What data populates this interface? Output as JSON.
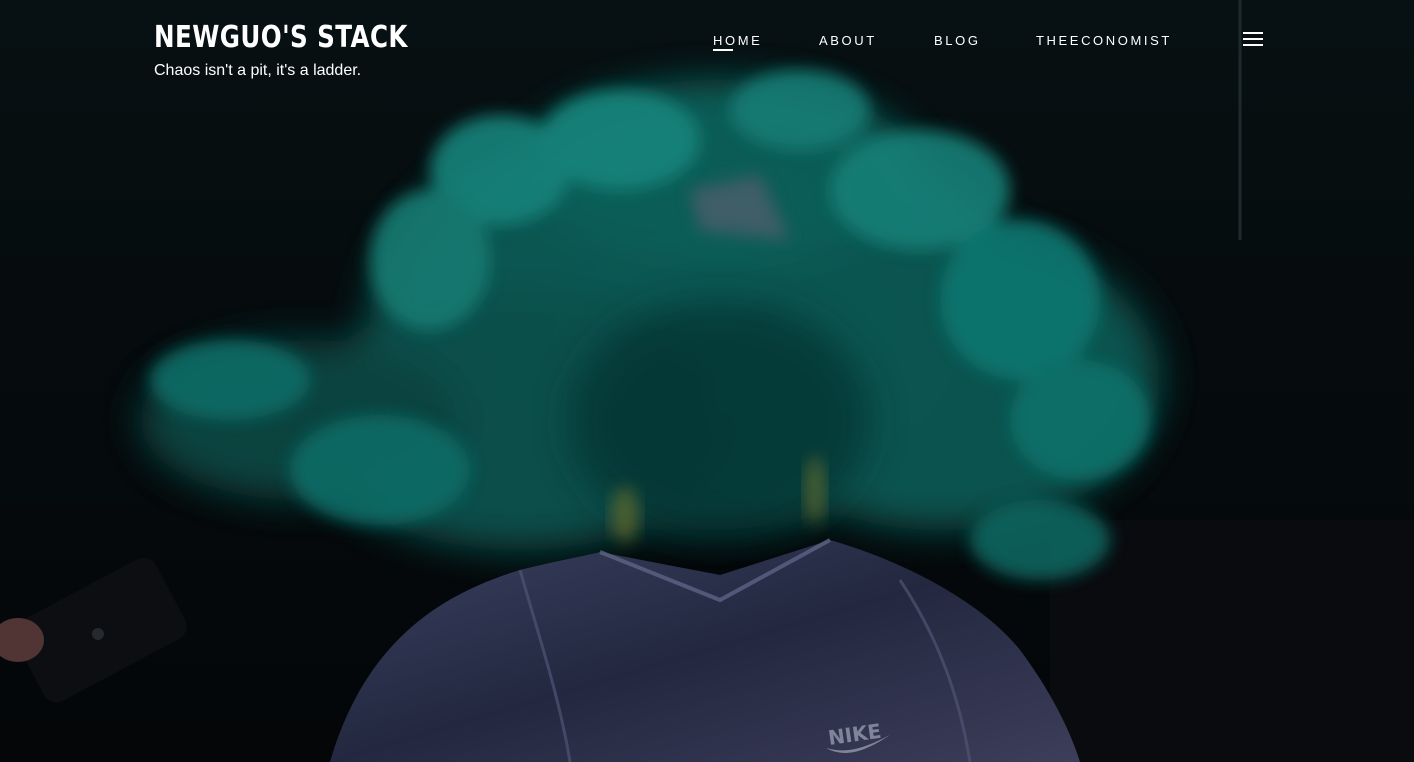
{
  "site": {
    "title": "NEWGUO'S STACK",
    "tagline": "Chaos isn't a pit, it's a ladder."
  },
  "nav": {
    "items": [
      {
        "label": "HOME",
        "active": true
      },
      {
        "label": "ABOUT",
        "active": false
      },
      {
        "label": "BLOG",
        "active": false
      },
      {
        "label": "THEECONOMIST",
        "active": false
      }
    ],
    "menu_icon": "hamburger-menu-icon"
  },
  "hero": {
    "description_icon": "hero-background-image",
    "shirt_logo_text": "NIKE"
  },
  "colors": {
    "text": "#ffffff",
    "smoke": "#0f6e68",
    "background": "#05070a",
    "shirt": "#2a2f45"
  }
}
